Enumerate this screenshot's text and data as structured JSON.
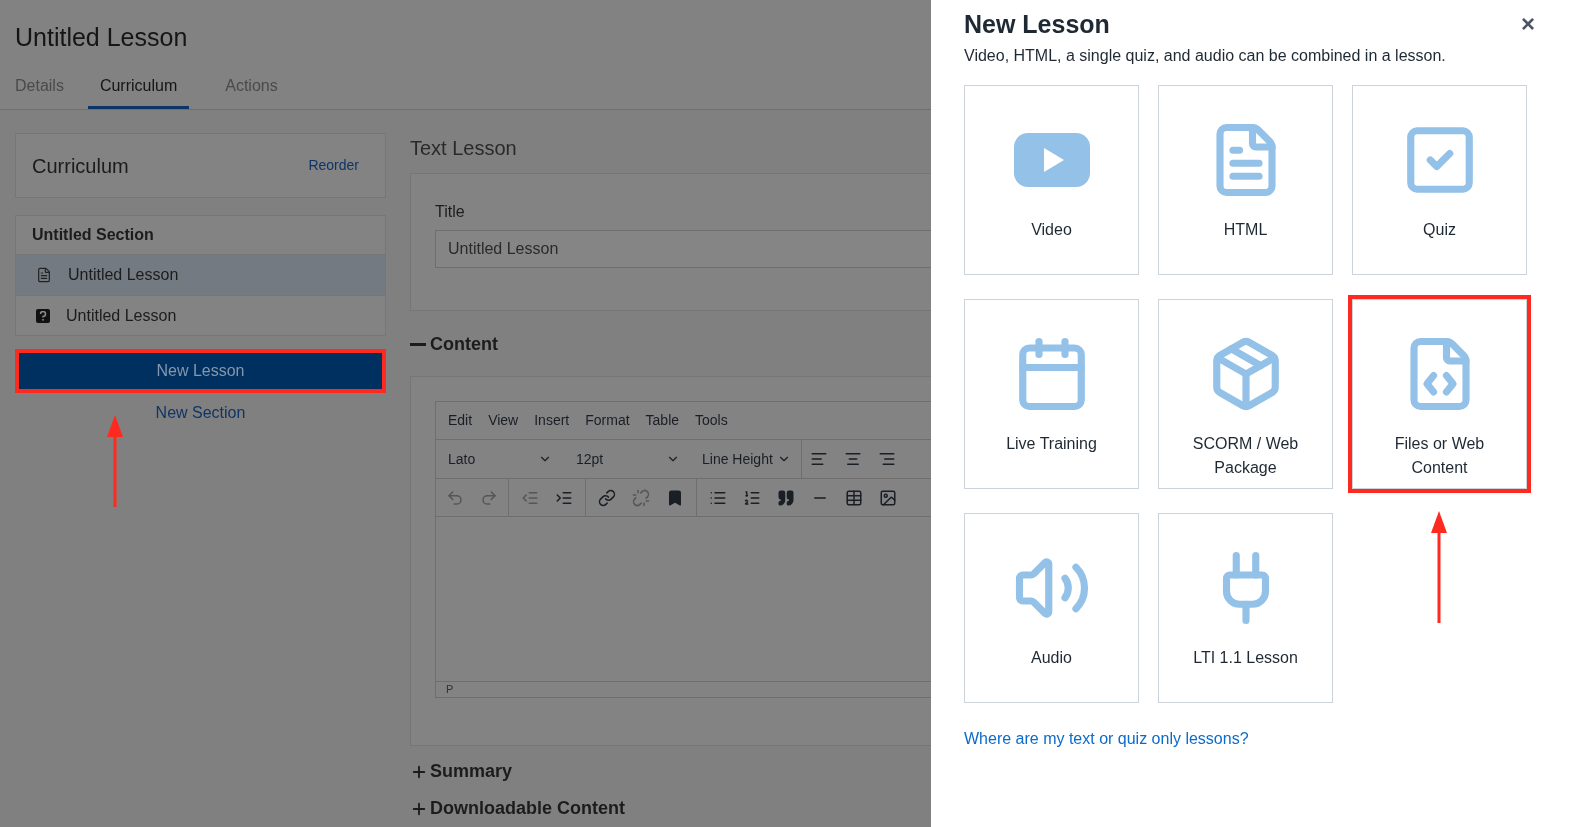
{
  "page": {
    "title": "Untitled Lesson",
    "tabs": [
      {
        "label": "Details",
        "selected": false
      },
      {
        "label": "Curriculum",
        "selected": true
      },
      {
        "label": "Actions",
        "selected": false
      }
    ],
    "curriculum": {
      "title": "Curriculum",
      "reorder": "Reorder"
    },
    "section": {
      "title": "Untitled Section",
      "lessons": [
        {
          "title": "Untitled Lesson",
          "kind": "text",
          "selected": true
        },
        {
          "title": "Untitled Lesson",
          "kind": "quiz",
          "selected": false
        }
      ]
    },
    "new_lesson_button": {
      "label": "New Lesson",
      "annotated": true
    },
    "new_section_link": "New Section",
    "lesson_editor": {
      "heading": "Text Lesson",
      "title_label": "Title",
      "title_value": "Untitled Lesson",
      "content": {
        "label": "Content",
        "expanded": true
      },
      "editor": {
        "menu": [
          "Edit",
          "View",
          "Insert",
          "Format",
          "Table",
          "Tools"
        ],
        "font": "Lato",
        "size": "12pt",
        "line_height": "Line Height",
        "status": "P"
      },
      "sections": [
        {
          "label": "Summary",
          "expanded": false
        },
        {
          "label": "Downloadable Content",
          "expanded": false
        }
      ]
    }
  },
  "dialog": {
    "title": "New Lesson",
    "subtitle": "Video, HTML, a single quiz, and audio can be combined in a lesson.",
    "close": "×",
    "options": [
      {
        "label": "Video",
        "kind": "video",
        "annotated": false
      },
      {
        "label": "HTML",
        "kind": "html",
        "annotated": false
      },
      {
        "label": "Quiz",
        "kind": "quiz",
        "annotated": false
      },
      {
        "label": "Live Training",
        "kind": "live",
        "annotated": false
      },
      {
        "label": "SCORM / Web Package",
        "kind": "scorm",
        "annotated": false
      },
      {
        "label": "Files or Web Content",
        "kind": "files",
        "annotated": true
      },
      {
        "label": "Audio",
        "kind": "audio",
        "annotated": false
      },
      {
        "label": "LTI 1.1 Lesson",
        "kind": "lti",
        "annotated": false
      }
    ],
    "help_link": "Where are my text or quiz only lessons?"
  }
}
